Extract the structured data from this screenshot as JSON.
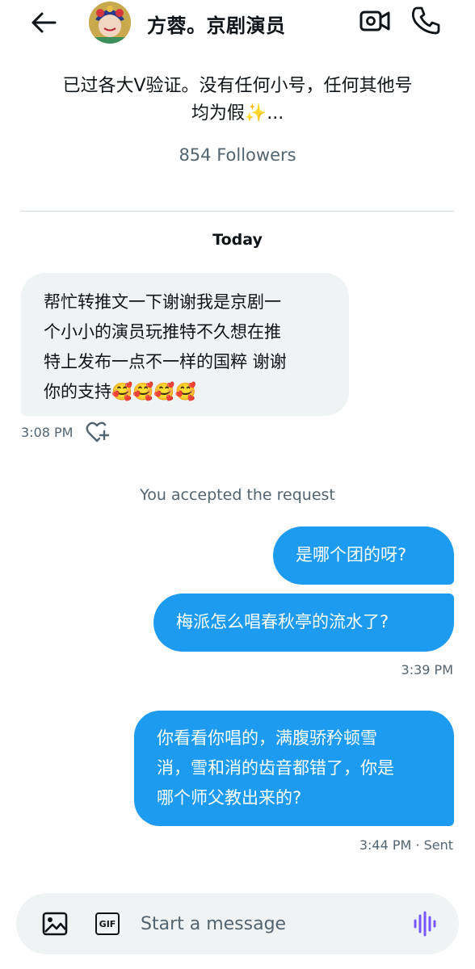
{
  "header": {
    "title": "方蓉。京剧演员"
  },
  "profile": {
    "bio_line1": "已过各大V验证。没有任何小号，任何其他号",
    "bio_line2": "均为假✨...",
    "followers": "854 Followers"
  },
  "conversation": {
    "date_label": "Today",
    "incoming": {
      "lines": [
        "帮忙转推文一下谢谢我是京剧一",
        "个小小的演员玩推特不久想在推",
        "特上发布一点不一样的国粹  谢谢",
        "你的支持🥰🥰🥰🥰"
      ],
      "time": "3:08 PM"
    },
    "system_message": "You accepted the request",
    "outgoing1": {
      "text": "是哪个团的呀?"
    },
    "outgoing2": {
      "text": "梅派怎么唱春秋亭的流水了?",
      "time": "3:39 PM"
    },
    "outgoing3": {
      "lines": [
        "你看看你唱的，满腹骄矜顿雪",
        "消，雪和消的齿音都错了，你是",
        "哪个师父教出来的?"
      ],
      "time": "3:44 PM · Sent"
    }
  },
  "composer": {
    "placeholder": "Start a message",
    "gif_label": "GIF"
  },
  "colors": {
    "accent": "#1d9bf0",
    "bubble_in": "#eff3f4",
    "secondary_text": "#536471",
    "voice_icon": "#7856ff"
  }
}
